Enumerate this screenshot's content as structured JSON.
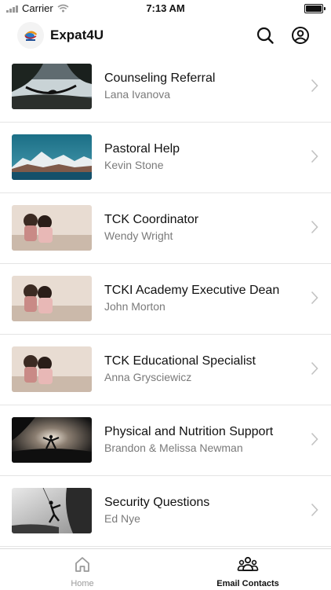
{
  "status": {
    "carrier": "Carrier",
    "time": "7:13 AM"
  },
  "header": {
    "title": "Expat4U",
    "search_icon": "search-icon",
    "profile_icon": "user-circle-icon"
  },
  "contacts": [
    {
      "title": "Counseling Referral",
      "name": "Lana Ivanova",
      "image": "hammock-lake"
    },
    {
      "title": "Pastoral Help",
      "name": "Kevin Stone",
      "image": "mountain-lake"
    },
    {
      "title": "TCK Coordinator",
      "name": "Wendy Wright",
      "image": "children-on-step"
    },
    {
      "title": "TCKI Academy Executive Dean",
      "name": "John Morton",
      "image": "children-on-step"
    },
    {
      "title": "TCK Educational Specialist",
      "name": "Anna Grysciewicz",
      "image": "children-on-step"
    },
    {
      "title": "Physical and Nutrition Support",
      "name": "Brandon & Melissa Newman",
      "image": "yoga-sunset"
    },
    {
      "title": "Security Questions",
      "name": "Ed Nye",
      "image": "climber-rock"
    }
  ],
  "tabs": [
    {
      "label": "Home",
      "icon": "home-icon",
      "active": false
    },
    {
      "label": "Email Contacts",
      "icon": "people-group-icon",
      "active": true
    }
  ],
  "colors": {
    "active_tab": "#111111",
    "inactive_tab": "#9a9a9a",
    "divider": "#e4e4e4"
  }
}
